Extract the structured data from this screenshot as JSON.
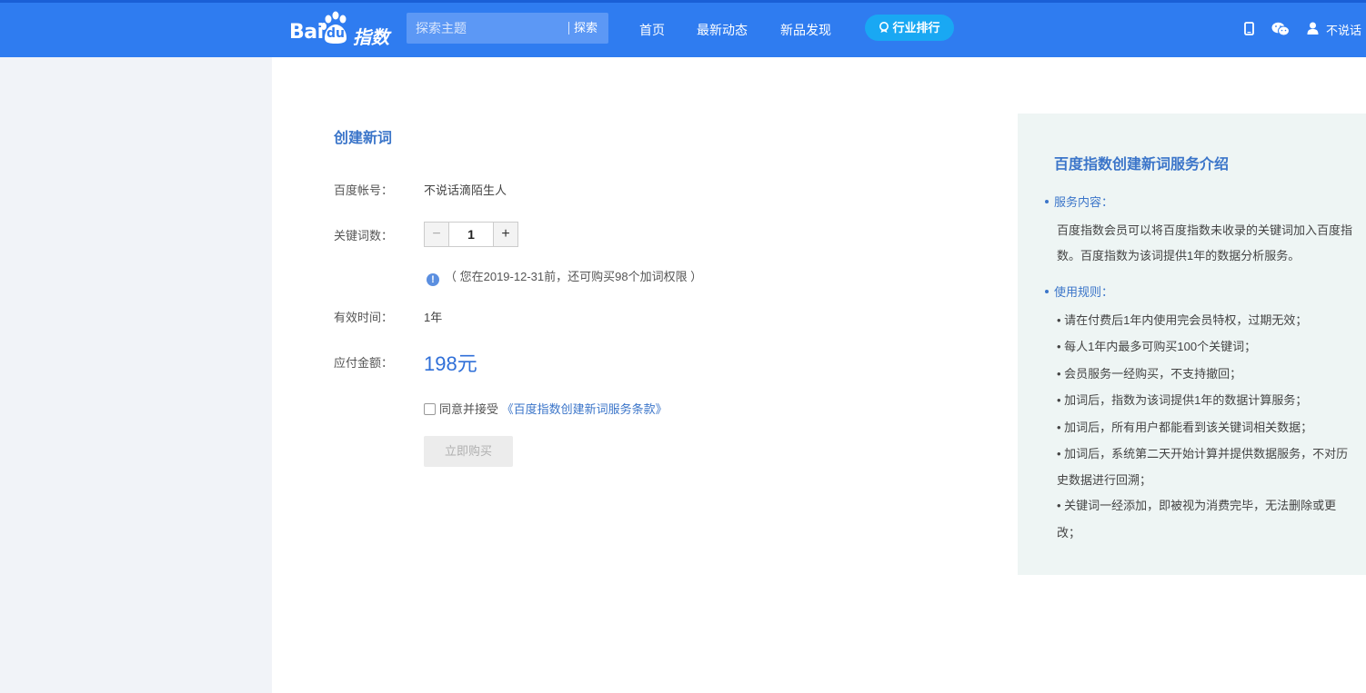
{
  "header": {
    "logo_bai": "Bai",
    "logo_du": "du",
    "logo_zhishu": "指数",
    "search": {
      "placeholder": "探索主题",
      "button": "探索"
    },
    "nav": [
      "首页",
      "最新动态",
      "新品发现"
    ],
    "rank_button": "行业排行",
    "icons": [
      "mobile-icon",
      "wechat-icon",
      "user-icon"
    ],
    "user_name": "不说话"
  },
  "form": {
    "title": "创建新词",
    "account_label": "百度帐号：",
    "account_value": "不说话滴陌生人",
    "keyword_count_label": "关键词数：",
    "keyword_count": "1",
    "minus": "−",
    "plus": "+",
    "tip_icon": "!",
    "tip": "（ 您在2019-12-31前，还可购买98个加词权限 ）",
    "valid_label": "有效时间：",
    "valid_value": "1年",
    "amount_label": "应付金额：",
    "amount_value": "198元",
    "agree_text": "同意并接受",
    "agree_link": "《百度指数创建新词服务条款》",
    "buy_button": "立即购买"
  },
  "panel": {
    "title": "百度指数创建新词服务介绍",
    "service_heading": "服务内容：",
    "service_lines": [
      "百度指数会员可以将百度指数未收录的关键词加入百度指",
      "数。百度指数为该词提供1年的数据分析服务。"
    ],
    "rules_heading": "使用规则：",
    "rules_lines": [
      "• 请在付费后1年内使用完会员特权，过期无效；",
      "• 每人1年内最多可购买100个关键词；",
      "• 会员服务一经购买，不支持撤回；",
      "• 加词后，指数为该词提供1年的数据计算服务；",
      "• 加词后，所有用户都能看到该关键词相关数据；",
      "• 加词后，系统第二天开始计算并提供数据服务，不对历",
      "史数据进行回溯；",
      "• 关键词一经添加，即被视为消费完毕，无法删除或更",
      "改；"
    ]
  },
  "colors": {
    "header": "#2f7cf0",
    "rank_button": "#19a8f3",
    "accent": "#3b75c9",
    "panel_bg": "#eef5f4"
  }
}
